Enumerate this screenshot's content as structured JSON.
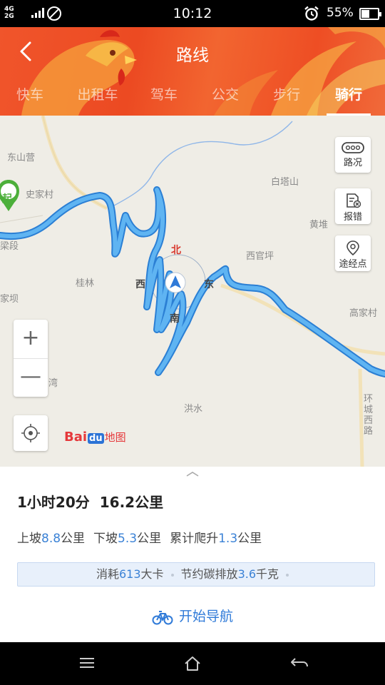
{
  "status_bar": {
    "network_top": "4G",
    "network_bottom": "2G",
    "time": "10:12",
    "battery_percent": 55,
    "battery_text": "55%"
  },
  "header": {
    "title": "路线",
    "tabs": [
      {
        "label": "快车",
        "active": false
      },
      {
        "label": "出租车",
        "active": false
      },
      {
        "label": "驾车",
        "active": false
      },
      {
        "label": "公交",
        "active": false
      },
      {
        "label": "步行",
        "active": false
      },
      {
        "label": "骑行",
        "active": true
      }
    ]
  },
  "map": {
    "labels": [
      "东山营",
      "史家村",
      "白塔山",
      "黄堆",
      "西官坪",
      "桂林",
      "家坝",
      "高家村",
      "洪水",
      "湾",
      "梁段",
      "环城西路"
    ],
    "compass": {
      "north": "北",
      "south": "南",
      "east": "东",
      "west": "西"
    },
    "start_marker": "起",
    "side_buttons": [
      {
        "label": "路况",
        "icon": "traffic-icon"
      },
      {
        "label": "报错",
        "icon": "report-error-icon"
      },
      {
        "label": "途经点",
        "icon": "waypoint-icon"
      }
    ],
    "zoom_in": "+",
    "zoom_out": "—",
    "logo": {
      "bai": "Bai",
      "du": "du",
      "zh": "地图"
    },
    "route_color": "#3a9ae8"
  },
  "route": {
    "duration": "1小时20分",
    "distance": "16.2公里",
    "uphill_label": "上坡",
    "uphill_value": "8.8",
    "uphill_unit": "公里",
    "downhill_label": "下坡",
    "downhill_value": "5.3",
    "downhill_unit": "公里",
    "climb_label": "累计爬升",
    "climb_value": "1.3",
    "climb_unit": "公里",
    "calories_label": "消耗",
    "calories_value": "613",
    "calories_unit": "大卡",
    "carbon_label": "节约碳排放",
    "carbon_value": "3.6",
    "carbon_unit": "千克",
    "start_nav": "开始导航"
  },
  "colors": {
    "header": "#ee4e24",
    "accent": "#2f7ad8",
    "start_marker": "#4caf3a"
  }
}
